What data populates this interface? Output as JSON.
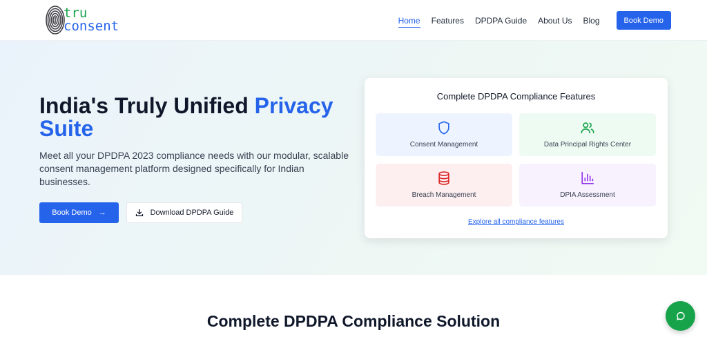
{
  "logo": {
    "line1": "tru",
    "line2": "consent",
    "icon": "fingerprint-icon"
  },
  "nav": {
    "items": [
      {
        "label": "Home",
        "active": true
      },
      {
        "label": "Features",
        "active": false
      },
      {
        "label": "DPDPA Guide",
        "active": false
      },
      {
        "label": "About Us",
        "active": false
      },
      {
        "label": "Blog",
        "active": false
      }
    ],
    "cta": "Book Demo"
  },
  "hero": {
    "title_main": "India's Truly Unified ",
    "title_accent": "Privacy Suite",
    "description": "Meet all your DPDPA 2023 compliance needs with our modular, scalable consent management platform designed specifically for Indian businesses.",
    "primary_button": "Book Demo",
    "primary_icon": "arrow-right-icon",
    "secondary_button": "Download DPDPA Guide",
    "secondary_icon": "download-icon"
  },
  "features_card": {
    "title": "Complete DPDPA Compliance Features",
    "tiles": [
      {
        "label": "Consent Management",
        "icon": "shield-icon",
        "color": "#2563eb"
      },
      {
        "label": "Data Principal Rights Center",
        "icon": "users-icon",
        "color": "#16a34a"
      },
      {
        "label": "Breach Management",
        "icon": "database-icon",
        "color": "#dc2626"
      },
      {
        "label": "DPIA Assessment",
        "icon": "bar-chart-icon",
        "color": "#9333ea"
      }
    ],
    "link": "Explore all compliance features"
  },
  "section": {
    "title": "Complete DPDPA Compliance Solution"
  },
  "chat": {
    "icon": "chat-bubble-icon"
  },
  "colors": {
    "accent": "#2563eb",
    "chat": "#16a34a"
  }
}
